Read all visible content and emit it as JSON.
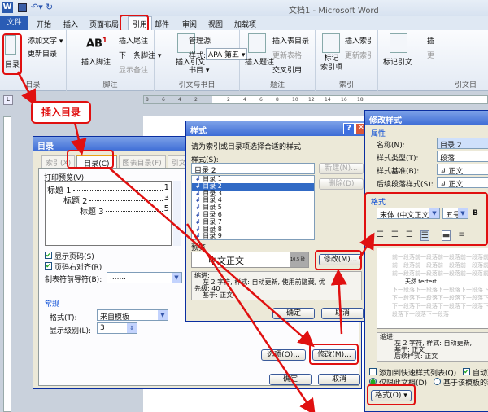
{
  "window": {
    "title": "文档1 - Microsoft Word",
    "quick_access": [
      "save-icon",
      "undo-icon",
      "redo-icon"
    ]
  },
  "tabs": [
    "文件",
    "开始",
    "插入",
    "页面布局",
    "引用",
    "邮件",
    "审阅",
    "视图",
    "加载项"
  ],
  "ribbon": {
    "toc": {
      "big": "目录",
      "items": [
        "添加文字 ▾",
        "更新目录"
      ],
      "label": "目录"
    },
    "footnote": {
      "big": "插入脚注",
      "items": [
        "插入尾注",
        "下一条脚注 ▾",
        "显示备注"
      ],
      "label": "脚注"
    },
    "citation": {
      "big": "插入引文",
      "items": [
        "管理源",
        "样式:",
        "书目 ▾"
      ],
      "style_value": "APA 第五 ▾",
      "label": "引文与书目"
    },
    "caption": {
      "big": "插入题注",
      "items": [
        "插入表目录",
        "更新表格",
        "交叉引用"
      ],
      "label": "题注"
    },
    "index": {
      "big": "标记\n索引项",
      "items": [
        "插入索引",
        "更新索引"
      ],
      "label": "索引"
    },
    "toa": {
      "big": "标记引文",
      "items": [
        "插",
        "更"
      ],
      "label": "引文目"
    }
  },
  "ruler": {
    "ticks": [
      "8",
      "6",
      "4",
      "2",
      "",
      "2",
      "4",
      "6",
      "8",
      "10",
      "12",
      "14",
      "16",
      "18"
    ]
  },
  "callout": "插入目录",
  "toc_dialog": {
    "title": "目录",
    "tabs": [
      "索引(X)",
      "目录(C)",
      "图表目录(F)",
      "引文目"
    ],
    "preview_label": "打印预览(V)",
    "preview": [
      {
        "t": "标题 1",
        "p": "1"
      },
      {
        "t": "标题 2",
        "p": "3"
      },
      {
        "t": "标题 3",
        "p": "5"
      }
    ],
    "show_page": "显示页码(S)",
    "right_align": "页码右对齐(R)",
    "leader_label": "制表符前导符(B):",
    "leader_value": ".......",
    "general": "常规",
    "format_label": "格式(T):",
    "format_value": "来自模板",
    "levels_label": "显示级别(L):",
    "levels_value": "3",
    "options": "选项(O)...",
    "modify": "修改(M)...",
    "ok": "确定",
    "cancel": "取消"
  },
  "style_dialog": {
    "title": "样式",
    "help": "?",
    "close": "✕",
    "prompt": "请为索引或目录项选择合适的样式",
    "styles_label": "样式(S):",
    "current": "目录 2",
    "list": [
      "目录 1",
      "目录 2",
      "目录 3",
      "目录 4",
      "目录 5",
      "目录 6",
      "目录 7",
      "目录 8",
      "目录 9"
    ],
    "selected_index": 1,
    "new": "新建(N)...",
    "delete": "删除(D)",
    "preview_label": "预览",
    "preview_text": "中文正文",
    "preview_size": "10.5 磅",
    "modify": "修改(M)...",
    "desc": [
      "缩进:",
      "左   2 字符, 样式: 自动更新, 使用前隐藏, 优",
      "先级: 40",
      "基于: 正文"
    ],
    "ok": "确定",
    "cancel": "取消"
  },
  "modify_dialog": {
    "title": "修改样式",
    "props": "属性",
    "rows": [
      {
        "l": "名称(N):",
        "v": "目录 2"
      },
      {
        "l": "样式类型(T):",
        "v": "段落"
      },
      {
        "l": "样式基准(B):",
        "v": "↲ 正文"
      },
      {
        "l": "后续段落样式(S):",
        "v": "↲ 正文"
      }
    ],
    "format": "格式",
    "font": "宋体 (中文正文",
    "size": "五号",
    "bold": "B",
    "prev_para": "前一段落前一段落前一段落前一段落前一段落前一段落前一段落前一段落前一段落前一段落前一段落",
    "sample": "天然 tertert",
    "next_para": "下一段落下一段落下一段落下一段落下一段落下一段落下一段落下一段落下一段落下一段落下一段落下一段落",
    "last_para": "段落下一段落下一段落",
    "desc": [
      "缩进:",
      "左  2 字符, 样式: 自动更新,",
      "基于: 正文",
      "后续样式: 正文"
    ],
    "add_quick": "添加到快速样式列表(Q)",
    "auto_update": "自动更",
    "only_doc": "仅限此文档(D)",
    "new_docs": "基于该模板的新",
    "format_btn": "格式(O) ▾"
  },
  "colors": {
    "accent": "#e01010",
    "title_blue": "#3c6bd6"
  }
}
